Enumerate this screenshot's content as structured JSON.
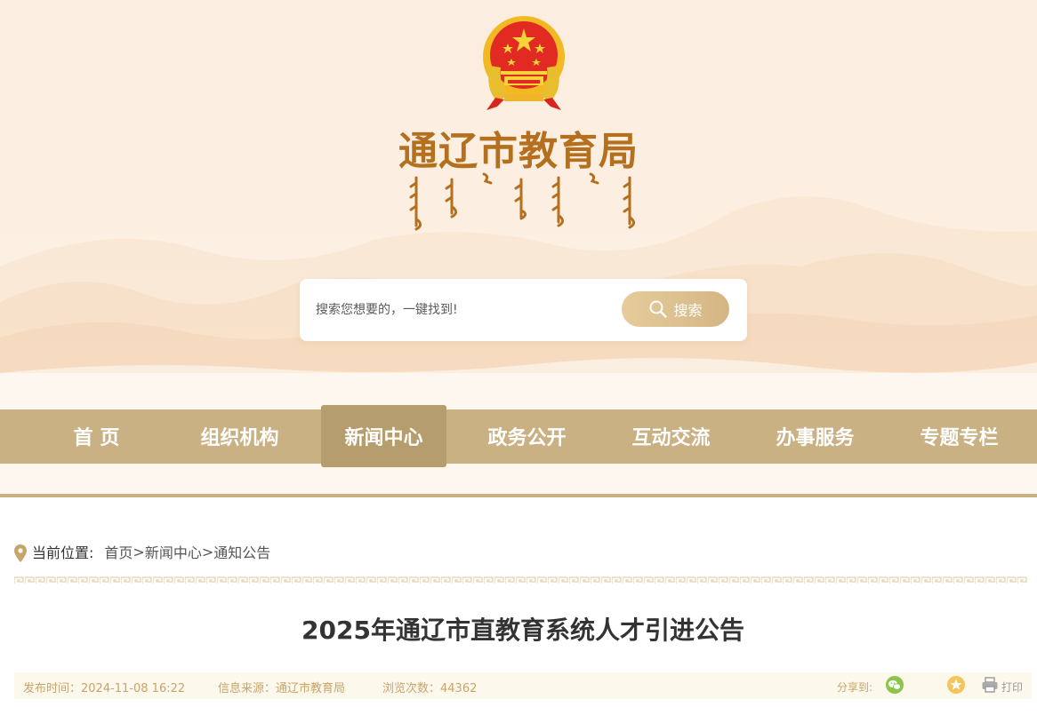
{
  "header": {
    "site_title": "通辽市教育局",
    "search": {
      "placeholder": "搜索您想要的，一键找到!",
      "button_label": "搜索"
    }
  },
  "nav": {
    "items": [
      {
        "label": "首 页",
        "active": false
      },
      {
        "label": "组织机构",
        "active": false
      },
      {
        "label": "新闻中心",
        "active": true
      },
      {
        "label": "政务公开",
        "active": false
      },
      {
        "label": "互动交流",
        "active": false
      },
      {
        "label": "办事服务",
        "active": false
      },
      {
        "label": "专题专栏",
        "active": false
      }
    ]
  },
  "breadcrumb": {
    "label": "当前位置:",
    "items": [
      "首页",
      "新闻中心",
      "通知公告"
    ],
    "separator": ">"
  },
  "article": {
    "title": "2025年通辽市直教育系统人才引进公告",
    "publish_time": "发布时间：2024-11-08 16:22",
    "source": "信息来源：通辽市教育局",
    "views": "浏览次数：44362",
    "share_label": "分享到:",
    "print_label": "打印"
  },
  "colors": {
    "nav_bg": "#c9b183",
    "nav_active": "#b69d6e",
    "title_gold": "#b4701e",
    "meta_text": "#c9a46a"
  }
}
